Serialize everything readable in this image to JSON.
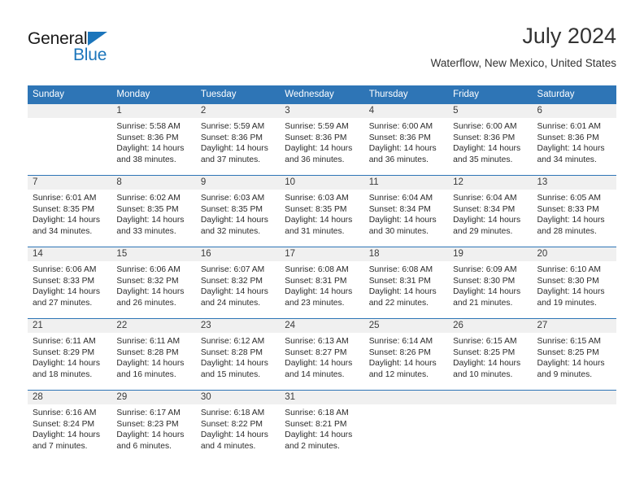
{
  "brand": {
    "name_part1": "General",
    "name_part2": "Blue",
    "accent_color": "#1b75bb"
  },
  "header": {
    "month_title": "July 2024",
    "location": "Waterflow, New Mexico, United States",
    "header_bar_color": "#2e75b6",
    "daynum_band_color": "#f0f0f0"
  },
  "weekdays": [
    "Sunday",
    "Monday",
    "Tuesday",
    "Wednesday",
    "Thursday",
    "Friday",
    "Saturday"
  ],
  "labels": {
    "sunrise_prefix": "Sunrise:",
    "sunset_prefix": "Sunset:",
    "daylight_prefix": "Daylight:"
  },
  "weeks": [
    [
      {
        "day": "",
        "sunrise": "",
        "sunset": "",
        "daylight": ""
      },
      {
        "day": "1",
        "sunrise": "Sunrise: 5:58 AM",
        "sunset": "Sunset: 8:36 PM",
        "daylight": "Daylight: 14 hours and 38 minutes."
      },
      {
        "day": "2",
        "sunrise": "Sunrise: 5:59 AM",
        "sunset": "Sunset: 8:36 PM",
        "daylight": "Daylight: 14 hours and 37 minutes."
      },
      {
        "day": "3",
        "sunrise": "Sunrise: 5:59 AM",
        "sunset": "Sunset: 8:36 PM",
        "daylight": "Daylight: 14 hours and 36 minutes."
      },
      {
        "day": "4",
        "sunrise": "Sunrise: 6:00 AM",
        "sunset": "Sunset: 8:36 PM",
        "daylight": "Daylight: 14 hours and 36 minutes."
      },
      {
        "day": "5",
        "sunrise": "Sunrise: 6:00 AM",
        "sunset": "Sunset: 8:36 PM",
        "daylight": "Daylight: 14 hours and 35 minutes."
      },
      {
        "day": "6",
        "sunrise": "Sunrise: 6:01 AM",
        "sunset": "Sunset: 8:36 PM",
        "daylight": "Daylight: 14 hours and 34 minutes."
      }
    ],
    [
      {
        "day": "7",
        "sunrise": "Sunrise: 6:01 AM",
        "sunset": "Sunset: 8:35 PM",
        "daylight": "Daylight: 14 hours and 34 minutes."
      },
      {
        "day": "8",
        "sunrise": "Sunrise: 6:02 AM",
        "sunset": "Sunset: 8:35 PM",
        "daylight": "Daylight: 14 hours and 33 minutes."
      },
      {
        "day": "9",
        "sunrise": "Sunrise: 6:03 AM",
        "sunset": "Sunset: 8:35 PM",
        "daylight": "Daylight: 14 hours and 32 minutes."
      },
      {
        "day": "10",
        "sunrise": "Sunrise: 6:03 AM",
        "sunset": "Sunset: 8:35 PM",
        "daylight": "Daylight: 14 hours and 31 minutes."
      },
      {
        "day": "11",
        "sunrise": "Sunrise: 6:04 AM",
        "sunset": "Sunset: 8:34 PM",
        "daylight": "Daylight: 14 hours and 30 minutes."
      },
      {
        "day": "12",
        "sunrise": "Sunrise: 6:04 AM",
        "sunset": "Sunset: 8:34 PM",
        "daylight": "Daylight: 14 hours and 29 minutes."
      },
      {
        "day": "13",
        "sunrise": "Sunrise: 6:05 AM",
        "sunset": "Sunset: 8:33 PM",
        "daylight": "Daylight: 14 hours and 28 minutes."
      }
    ],
    [
      {
        "day": "14",
        "sunrise": "Sunrise: 6:06 AM",
        "sunset": "Sunset: 8:33 PM",
        "daylight": "Daylight: 14 hours and 27 minutes."
      },
      {
        "day": "15",
        "sunrise": "Sunrise: 6:06 AM",
        "sunset": "Sunset: 8:32 PM",
        "daylight": "Daylight: 14 hours and 26 minutes."
      },
      {
        "day": "16",
        "sunrise": "Sunrise: 6:07 AM",
        "sunset": "Sunset: 8:32 PM",
        "daylight": "Daylight: 14 hours and 24 minutes."
      },
      {
        "day": "17",
        "sunrise": "Sunrise: 6:08 AM",
        "sunset": "Sunset: 8:31 PM",
        "daylight": "Daylight: 14 hours and 23 minutes."
      },
      {
        "day": "18",
        "sunrise": "Sunrise: 6:08 AM",
        "sunset": "Sunset: 8:31 PM",
        "daylight": "Daylight: 14 hours and 22 minutes."
      },
      {
        "day": "19",
        "sunrise": "Sunrise: 6:09 AM",
        "sunset": "Sunset: 8:30 PM",
        "daylight": "Daylight: 14 hours and 21 minutes."
      },
      {
        "day": "20",
        "sunrise": "Sunrise: 6:10 AM",
        "sunset": "Sunset: 8:30 PM",
        "daylight": "Daylight: 14 hours and 19 minutes."
      }
    ],
    [
      {
        "day": "21",
        "sunrise": "Sunrise: 6:11 AM",
        "sunset": "Sunset: 8:29 PM",
        "daylight": "Daylight: 14 hours and 18 minutes."
      },
      {
        "day": "22",
        "sunrise": "Sunrise: 6:11 AM",
        "sunset": "Sunset: 8:28 PM",
        "daylight": "Daylight: 14 hours and 16 minutes."
      },
      {
        "day": "23",
        "sunrise": "Sunrise: 6:12 AM",
        "sunset": "Sunset: 8:28 PM",
        "daylight": "Daylight: 14 hours and 15 minutes."
      },
      {
        "day": "24",
        "sunrise": "Sunrise: 6:13 AM",
        "sunset": "Sunset: 8:27 PM",
        "daylight": "Daylight: 14 hours and 14 minutes."
      },
      {
        "day": "25",
        "sunrise": "Sunrise: 6:14 AM",
        "sunset": "Sunset: 8:26 PM",
        "daylight": "Daylight: 14 hours and 12 minutes."
      },
      {
        "day": "26",
        "sunrise": "Sunrise: 6:15 AM",
        "sunset": "Sunset: 8:25 PM",
        "daylight": "Daylight: 14 hours and 10 minutes."
      },
      {
        "day": "27",
        "sunrise": "Sunrise: 6:15 AM",
        "sunset": "Sunset: 8:25 PM",
        "daylight": "Daylight: 14 hours and 9 minutes."
      }
    ],
    [
      {
        "day": "28",
        "sunrise": "Sunrise: 6:16 AM",
        "sunset": "Sunset: 8:24 PM",
        "daylight": "Daylight: 14 hours and 7 minutes."
      },
      {
        "day": "29",
        "sunrise": "Sunrise: 6:17 AM",
        "sunset": "Sunset: 8:23 PM",
        "daylight": "Daylight: 14 hours and 6 minutes."
      },
      {
        "day": "30",
        "sunrise": "Sunrise: 6:18 AM",
        "sunset": "Sunset: 8:22 PM",
        "daylight": "Daylight: 14 hours and 4 minutes."
      },
      {
        "day": "31",
        "sunrise": "Sunrise: 6:18 AM",
        "sunset": "Sunset: 8:21 PM",
        "daylight": "Daylight: 14 hours and 2 minutes."
      },
      {
        "day": "",
        "sunrise": "",
        "sunset": "",
        "daylight": ""
      },
      {
        "day": "",
        "sunrise": "",
        "sunset": "",
        "daylight": ""
      },
      {
        "day": "",
        "sunrise": "",
        "sunset": "",
        "daylight": ""
      }
    ]
  ]
}
